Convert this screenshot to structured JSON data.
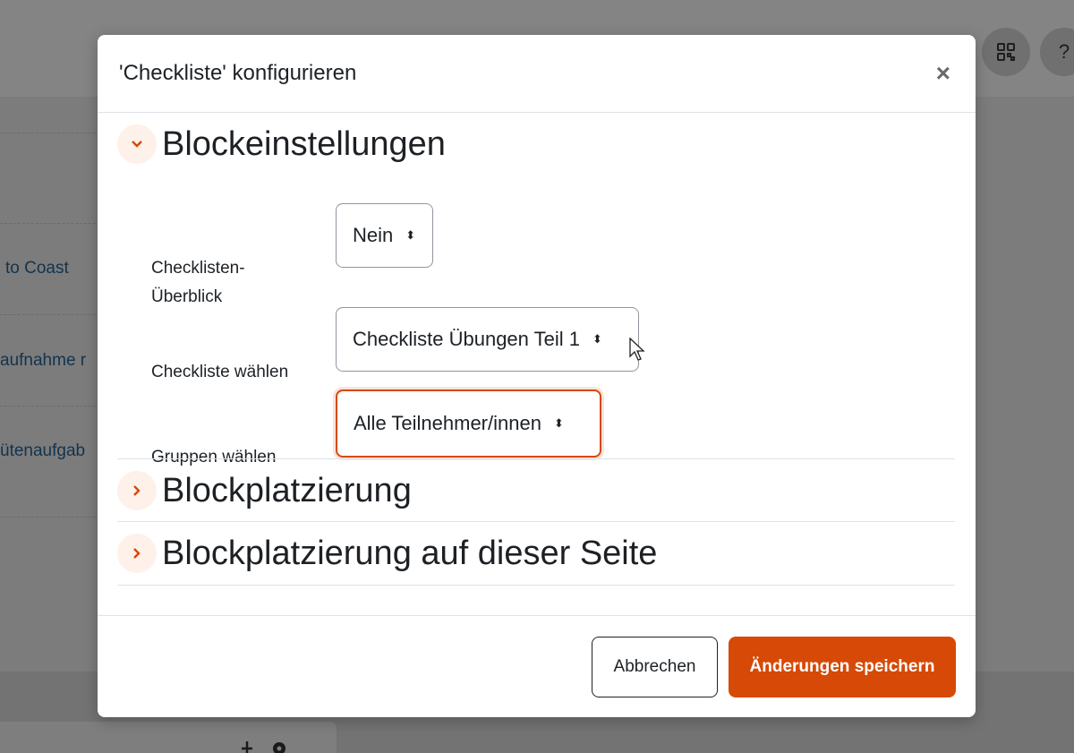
{
  "background": {
    "links": [
      "to Coast",
      "aufnahme r",
      "ütenaufgab"
    ],
    "top_icons": [
      "qr-code-icon",
      "help-icon"
    ],
    "help_glyph": "?"
  },
  "modal": {
    "title": "'Checkliste' konfigurieren",
    "close_glyph": "×",
    "sections": [
      {
        "title": "Blockeinstellungen",
        "expanded": true
      },
      {
        "title": "Blockplatzierung",
        "expanded": false
      },
      {
        "title": "Blockplatzierung auf dieser Seite",
        "expanded": false
      }
    ],
    "fields": {
      "overview": {
        "label_line1": "Checklisten-",
        "label_line2": "Überblick",
        "value": "Nein"
      },
      "checklist": {
        "label": "Checkliste wählen",
        "value": "Checkliste Übungen Teil 1"
      },
      "groups": {
        "label": "Gruppen wählen",
        "value": "Alle Teilnehmer/innen"
      }
    },
    "buttons": {
      "cancel": "Abbrechen",
      "save": "Änderungen speichern"
    }
  },
  "colors": {
    "accent": "#d64906",
    "border": "#dee2e6"
  }
}
